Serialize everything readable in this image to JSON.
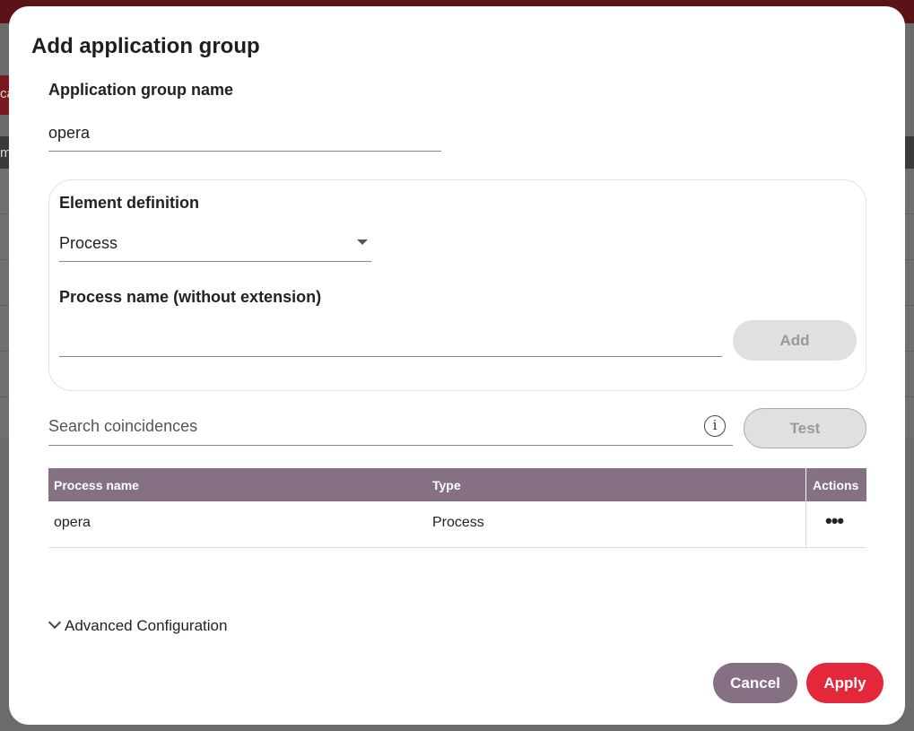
{
  "background": {
    "stub_a": "ca",
    "stub_b": "m"
  },
  "dialog": {
    "title": "Add application group",
    "group_name_label": "Application group name",
    "group_name_value": "opera",
    "element_definition_label": "Element definition",
    "element_definition_value": "Process",
    "process_name_label": "Process name (without extension)",
    "process_name_value": "",
    "add_label": "Add",
    "search_placeholder": "Search coincidences",
    "info_glyph": "i",
    "test_label": "Test",
    "table": {
      "columns": [
        "Process name",
        "Type",
        "Actions"
      ],
      "rows": [
        {
          "name": "opera",
          "type": "Process",
          "actions": "•••"
        }
      ]
    },
    "advanced_label": "Advanced Configuration",
    "cancel_label": "Cancel",
    "apply_label": "Apply"
  },
  "colors": {
    "header": "#867184",
    "primary": "#e3283b",
    "disabled": "#e0e0e0"
  },
  "icons": [
    "caret-down-icon",
    "info-icon",
    "more-dots-icon",
    "chevron-down-icon"
  ]
}
